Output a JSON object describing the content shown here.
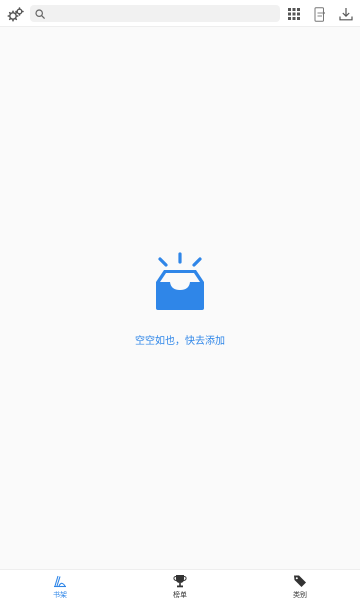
{
  "colors": {
    "accent": "#2f86e8",
    "background": "#fafafa",
    "icon_gray": "#555555"
  },
  "header": {
    "settings_icon": "gears-icon",
    "search": {
      "icon": "search-icon",
      "placeholder": "",
      "value": ""
    },
    "actions": [
      {
        "name": "grid-menu-icon"
      },
      {
        "name": "phone-transfer-icon"
      },
      {
        "name": "download-icon"
      }
    ]
  },
  "empty_state": {
    "icon": "empty-tray-icon",
    "message": "空空如也，快去添加"
  },
  "bottom_nav": {
    "active_index": 0,
    "items": [
      {
        "label": "书架",
        "icon": "bookshelf-icon"
      },
      {
        "label": "榜单",
        "icon": "trophy-icon"
      },
      {
        "label": "类别",
        "icon": "tags-icon"
      }
    ]
  }
}
